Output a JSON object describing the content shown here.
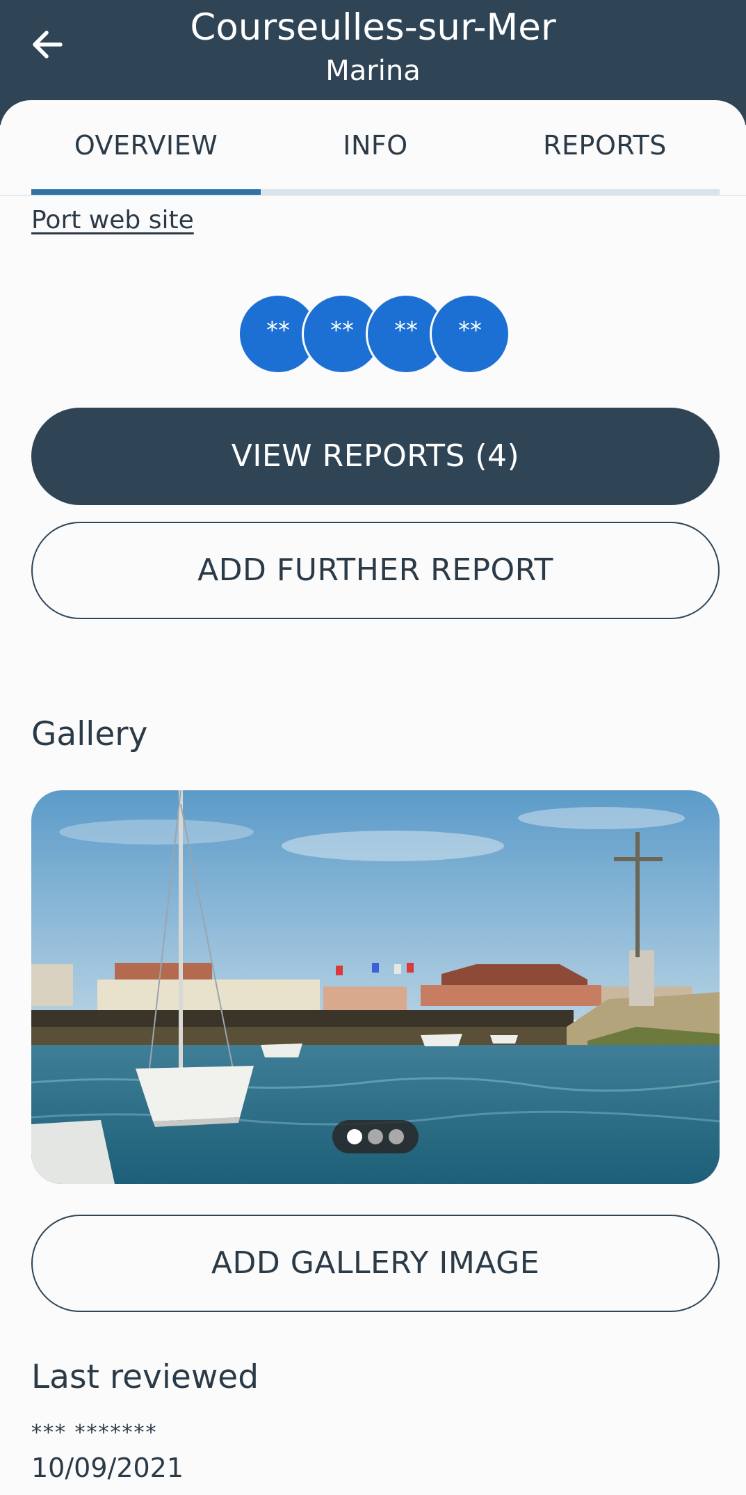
{
  "header": {
    "title": "Courseulles-sur-Mer",
    "subtitle": "Marina",
    "back_icon": "arrow-left-icon"
  },
  "tabs": [
    {
      "label": "OVERVIEW",
      "active": true
    },
    {
      "label": "INFO",
      "active": false
    },
    {
      "label": "REPORTS",
      "active": false
    }
  ],
  "overview": {
    "port_link": "Port web site",
    "rating_bubbles": [
      "**",
      "**",
      "**",
      "**"
    ],
    "view_reports_button": "VIEW REPORTS (4)",
    "add_report_button": "ADD FURTHER REPORT"
  },
  "gallery": {
    "title": "Gallery",
    "image_subject": "marina-harbour-photo",
    "pager_dots": 3,
    "active_dot": 1,
    "add_image_button": "ADD GALLERY IMAGE"
  },
  "last_reviewed": {
    "title": "Last reviewed",
    "reviewer": "*** *******",
    "date": "10/09/2021"
  },
  "colors": {
    "header_bg": "#2f4556",
    "accent_blue": "#1c70d3",
    "tab_indicator": "#2f72a8",
    "text": "#2b3a47"
  }
}
